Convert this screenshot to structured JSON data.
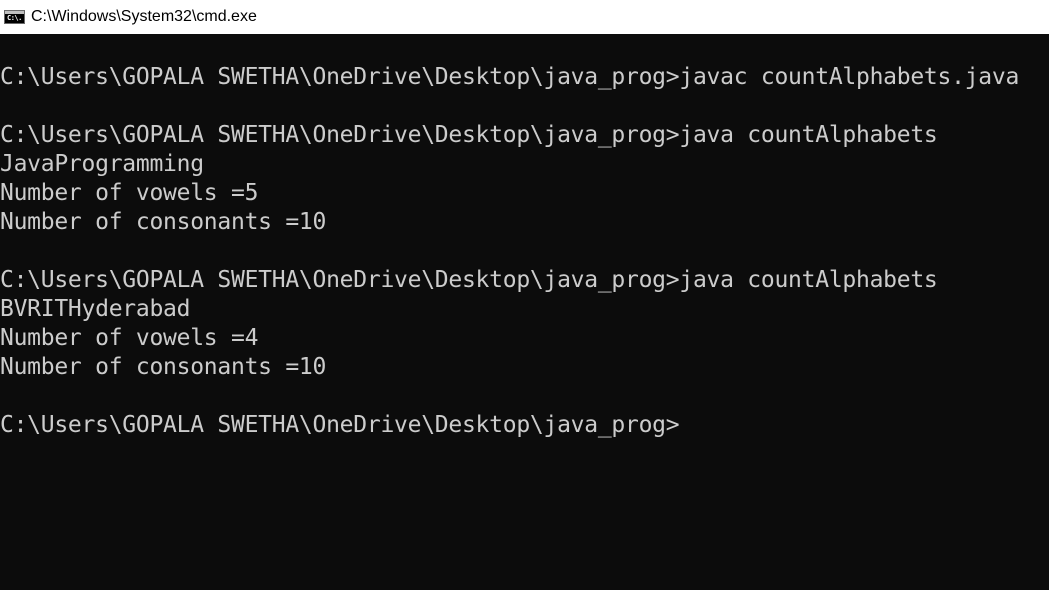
{
  "window": {
    "title": "C:\\Windows\\System32\\cmd.exe",
    "icon": "cmd-console-icon",
    "icon_glyph": "C:\\."
  },
  "console": {
    "lines": [
      "C:\\Users\\GOPALA SWETHA\\OneDrive\\Desktop\\java_prog>javac countAlphabets.java",
      "",
      "C:\\Users\\GOPALA SWETHA\\OneDrive\\Desktop\\java_prog>java countAlphabets",
      "JavaProgramming",
      "Number of vowels =5",
      "Number of consonants =10",
      "",
      "C:\\Users\\GOPALA SWETHA\\OneDrive\\Desktop\\java_prog>java countAlphabets",
      "BVRITHyderabad",
      "Number of vowels =4",
      "Number of consonants =10",
      "",
      "C:\\Users\\GOPALA SWETHA\\OneDrive\\Desktop\\java_prog>"
    ]
  },
  "colors": {
    "console_background": "#0c0c0c",
    "console_text": "#cccccc",
    "titlebar_background": "#ffffff",
    "titlebar_text": "#000000"
  }
}
